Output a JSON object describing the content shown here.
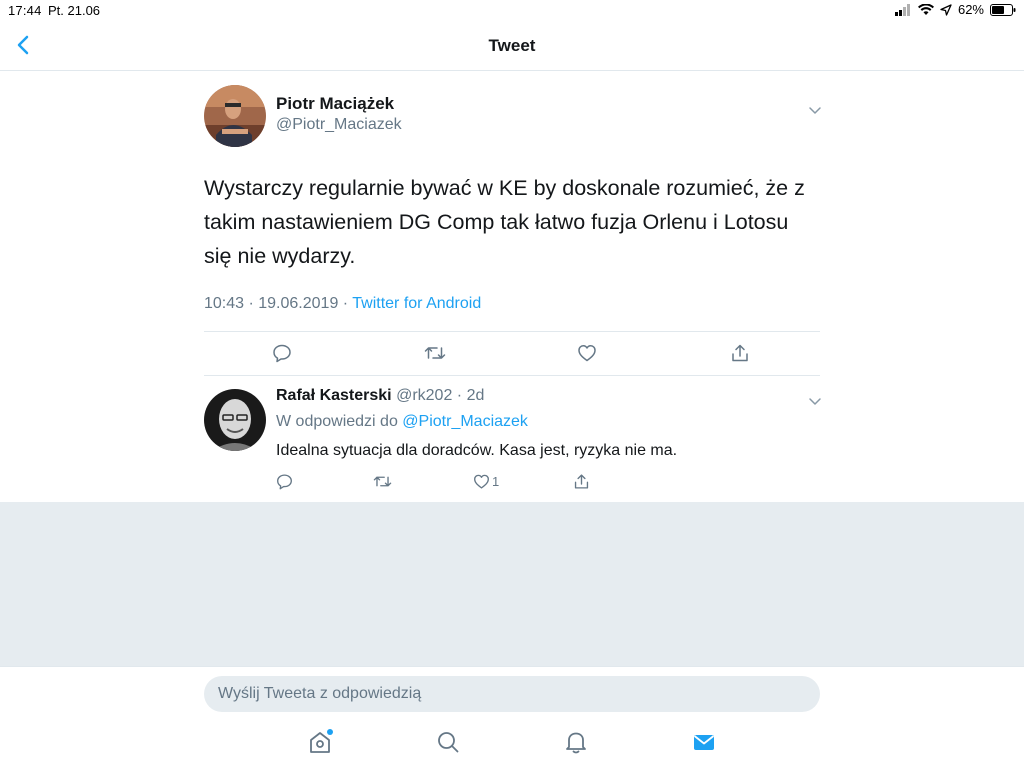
{
  "status_bar": {
    "time": "17:44",
    "date": "Pt. 21.06",
    "battery": "62%"
  },
  "nav": {
    "title": "Tweet"
  },
  "tweet": {
    "author_name": "Piotr Maciążek",
    "author_handle": "@Piotr_Maciazek",
    "text_line_1": "Wystarczy regularnie bywać w KE by doskonale rozumieć, że z",
    "text_line_2": "takim nastawieniem DG Comp tak łatwo fuzja Orlenu i Lotosu",
    "text_line_3": "się nie wydarzy.",
    "timestamp": "10:43 · 19.06.2019 · ",
    "source": "Twitter for Android"
  },
  "reply": {
    "author_name": "Rafał Kasterski",
    "author_handle": "@rk202 · 2d",
    "context_prefix": "W odpowiedzi do ",
    "context_mention": "@Piotr_Maciazek",
    "text": "Idealna sytuacja dla doradców. Kasa jest, ryzyka nie ma.",
    "like_count": "1"
  },
  "compose": {
    "placeholder": "Wyślij Tweeta z odpowiedzią"
  },
  "colors": {
    "accent": "#1da1f2",
    "muted": "#657786",
    "background_grey": "#e6ecf0"
  },
  "icons": {
    "back": "chevron-left-icon",
    "reply": "reply-icon",
    "retweet": "retweet-icon",
    "like": "heart-icon",
    "share": "share-icon",
    "home": "home-icon",
    "search": "search-icon",
    "notifications": "bell-icon",
    "messages": "mail-icon"
  }
}
